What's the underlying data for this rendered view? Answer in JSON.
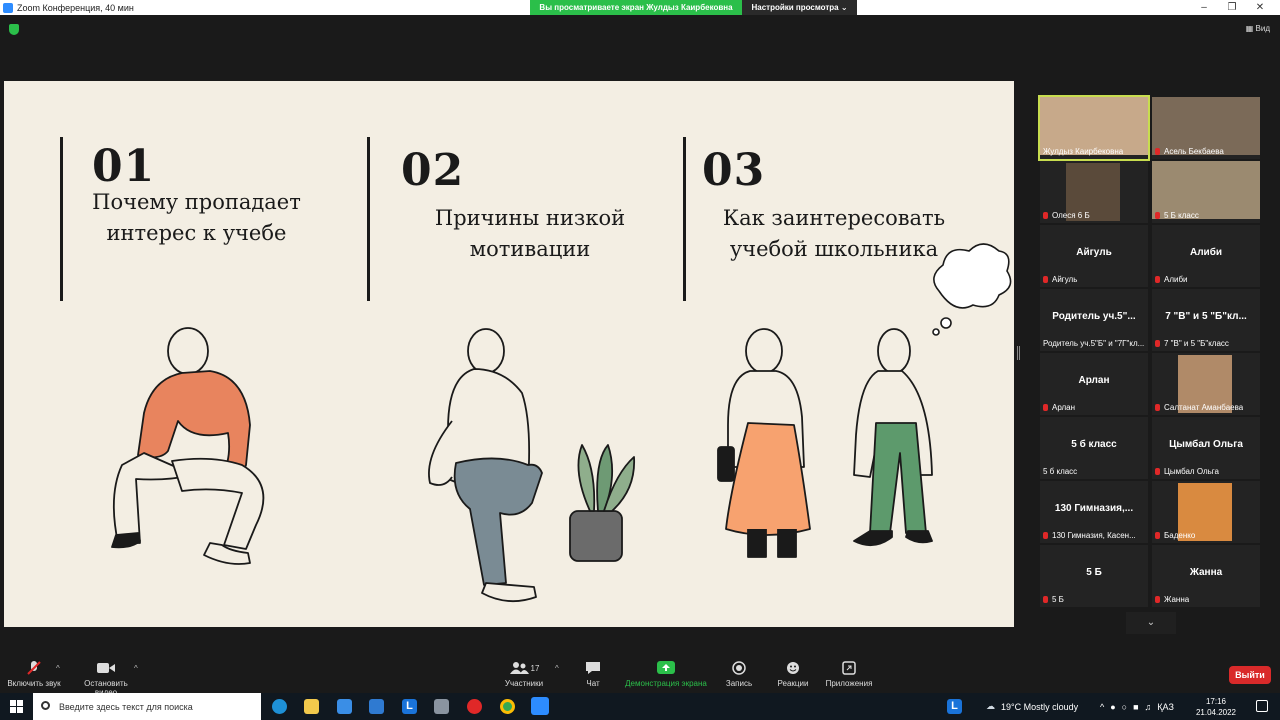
{
  "window": {
    "title": "Zoom Конференция, 40 мин",
    "share_notice": "Вы просматриваете экран Жулдыз Каирбековна",
    "view_options": "Настройки просмотра ⌄",
    "view_button": "Вид"
  },
  "slide": {
    "sections": [
      {
        "number": "01",
        "line1": "Почему пропадает",
        "line2": "интерес к учебе"
      },
      {
        "number": "02",
        "line1": "Причины низкой",
        "line2": "мотивации"
      },
      {
        "number": "03",
        "line1": "Как заинтересовать",
        "line2": "учебой школьника"
      }
    ],
    "colors": {
      "background": "#f3eee3",
      "orange": "#e8845e",
      "green": "#5d9a6c",
      "gray": "#7a8b94",
      "ink": "#1a1a1a"
    }
  },
  "participants": [
    {
      "tile_name": "",
      "caption": "Жулдыз Каирбековна",
      "video": true,
      "active": true,
      "muted": false
    },
    {
      "tile_name": "",
      "caption": "Асель Бекбаева",
      "video": true,
      "active": false,
      "muted": true
    },
    {
      "tile_name": "",
      "caption": "Олеся 6 Б",
      "video": true,
      "active": false,
      "muted": true
    },
    {
      "tile_name": "",
      "caption": "5 Б класс",
      "video": true,
      "active": false,
      "muted": true
    },
    {
      "tile_name": "Айгуль",
      "caption": "Айгуль",
      "video": false,
      "active": false,
      "muted": true
    },
    {
      "tile_name": "Алиби",
      "caption": "Алиби",
      "video": false,
      "active": false,
      "muted": true
    },
    {
      "tile_name": "Родитель  уч.5\"...",
      "caption": "Родитель уч.5\"Б\" и \"7Г\"кл...",
      "video": false,
      "active": false,
      "muted": false
    },
    {
      "tile_name": "7 \"В\"  и 5 \"Б\"кл...",
      "caption": "7 \"В\"  и 5 \"Б\"класс",
      "video": false,
      "active": false,
      "muted": true
    },
    {
      "tile_name": "Арлан",
      "caption": "Арлан",
      "video": false,
      "active": false,
      "muted": true
    },
    {
      "tile_name": "",
      "caption": "Салтанат Аманбаева",
      "video": true,
      "active": false,
      "muted": true
    },
    {
      "tile_name": "5 б класс",
      "caption": "5 б класс",
      "video": false,
      "active": false,
      "muted": false
    },
    {
      "tile_name": "Цымбал Ольга",
      "caption": "Цымбал Ольга",
      "video": false,
      "active": false,
      "muted": true
    },
    {
      "tile_name": "130  Гимназия,...",
      "caption": "130 Гимназия, Касен...",
      "video": false,
      "active": false,
      "muted": true
    },
    {
      "tile_name": "",
      "caption": "Баденко",
      "video": true,
      "active": false,
      "muted": true
    },
    {
      "tile_name": "5 Б",
      "caption": "5 Б",
      "video": false,
      "active": false,
      "muted": true
    },
    {
      "tile_name": "Жанна",
      "caption": "Жанна",
      "video": false,
      "active": false,
      "muted": true
    }
  ],
  "more_icon": "chevron-down-icon",
  "toolbar": {
    "unmute": "Включить звук",
    "stop_video": "Остановить видео",
    "participants": "Участники",
    "participants_count": "17",
    "chat": "Чат",
    "share_screen": "Демонстрация экрана",
    "record": "Запись",
    "reactions": "Реакции",
    "apps": "Приложения",
    "leave": "Выйти"
  },
  "taskbar": {
    "search_placeholder": "Введите здесь текст для поиска",
    "weather": "19°C  Mostly cloudy",
    "lang": "ҚАЗ",
    "time": "17:16",
    "date": "21.04.2022"
  }
}
